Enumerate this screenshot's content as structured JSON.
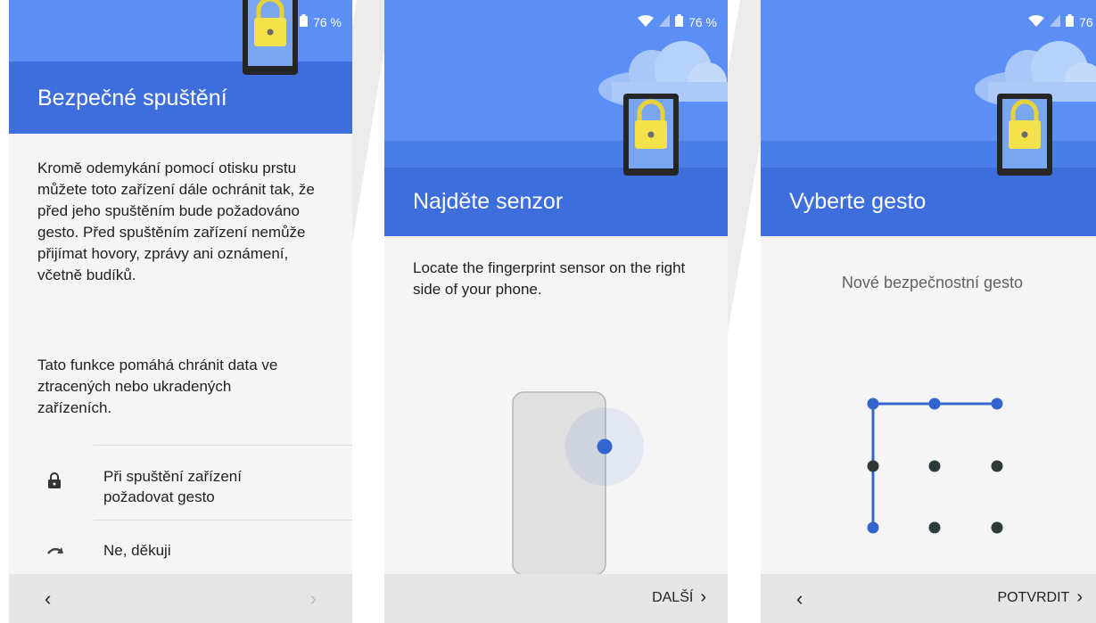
{
  "status": {
    "battery": "76 %"
  },
  "screen1": {
    "title": "Bezpečné spuštění",
    "paragraph1": "Kromě odemykání pomocí otisku prstu můžete toto zařízení dále ochránit tak, že před jeho spuštěním bude požadováno gesto. Před spuštěním zařízení nemůže přijímat hovory, zprávy ani oznámení, včetně budíků.",
    "paragraph2": "Tato funkce pomáhá chránit data ve ztracených nebo ukradených zařízeních.",
    "options": [
      {
        "label": "Při spuštění zařízení požadovat gesto",
        "icon": "lock-icon"
      },
      {
        "label": "Ne, děkuji",
        "icon": "skip-arrow-icon"
      }
    ],
    "nav": {
      "back": "‹",
      "forward": "›"
    }
  },
  "screen2": {
    "title": "Najděte senzor",
    "body": "Locate the fingerprint sensor on the right side of your phone.",
    "next_label": "DALŠÍ"
  },
  "screen3": {
    "title": "Vyberte gesto",
    "subtitle": "Nové bezpečnostní gesto",
    "confirm_label": "POTVRDIT",
    "back": "‹",
    "pattern_path": [
      7,
      1,
      2,
      3
    ]
  },
  "colors": {
    "header_blue": "#5b8ff5",
    "title_band_blue": "#3d6edc",
    "accent_blue": "#3366cc",
    "lock_yellow": "#f5e24a",
    "nav_grey": "#e6e6e6"
  }
}
